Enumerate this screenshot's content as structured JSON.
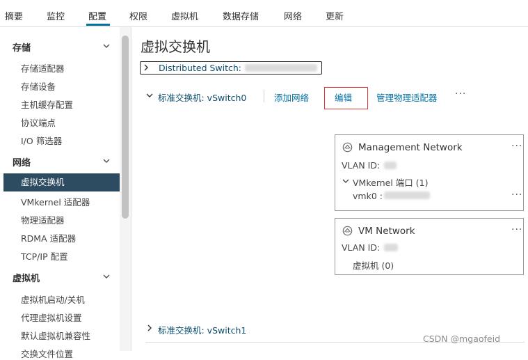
{
  "topnav": {
    "tabs": [
      "摘要",
      "监控",
      "配置",
      "权限",
      "虚拟机",
      "数据存储",
      "网络",
      "更新"
    ],
    "active": "配置"
  },
  "sidebar": {
    "sections": [
      {
        "label": "存储",
        "items": [
          "存储适配器",
          "存储设备",
          "主机缓存配置",
          "协议端点",
          "I/O 筛选器"
        ]
      },
      {
        "label": "网络",
        "items": [
          "虚拟交换机",
          "VMkernel 适配器",
          "物理适配器",
          "RDMA 适配器",
          "TCP/IP 配置"
        ]
      },
      {
        "label": "虚拟机",
        "items": [
          "虚拟机启动/关机",
          "代理虚拟机设置",
          "默认虚拟机兼容性",
          "交换文件位置"
        ]
      }
    ],
    "active_item": "虚拟交换机"
  },
  "main": {
    "title": "虚拟交换机",
    "distributed_switch_label": "Distributed Switch:",
    "vswitch0": {
      "label": "标准交换机: vSwitch0",
      "actions": [
        "添加网络",
        "编辑",
        "管理物理适配器"
      ],
      "more": "···"
    },
    "cards": [
      {
        "title": "Management Network",
        "vlan_label": "VLAN ID:",
        "group_label": "VMkernel 端口 (1)",
        "vmk": "vmk0 :",
        "more": "···"
      },
      {
        "title": "VM Network",
        "vlan_label": "VLAN ID:",
        "vms_label": "虚拟机 (0)",
        "more": "···"
      }
    ],
    "vswitch1_label": "标准交换机: vSwitch1"
  },
  "watermark": "CSDN @mgaofeid"
}
